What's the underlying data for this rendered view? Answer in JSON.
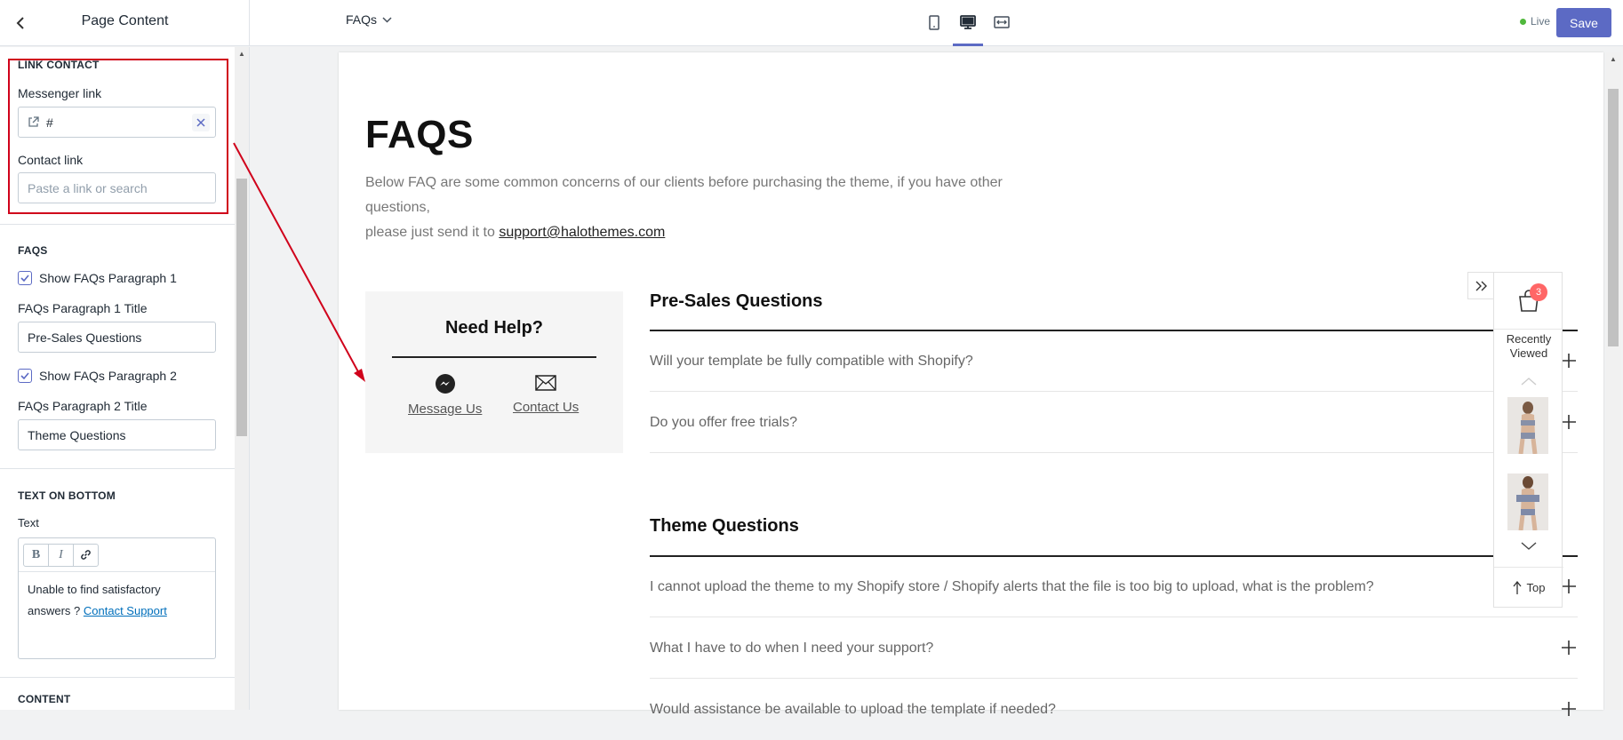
{
  "topbar": {
    "panel_title": "Page Content",
    "page_selector": "FAQs",
    "live_label": "Live",
    "save_label": "Save"
  },
  "sidebar": {
    "link_contact": {
      "heading": "LINK CONTACT",
      "messenger_label": "Messenger link",
      "messenger_value": "#",
      "contact_label": "Contact link",
      "contact_placeholder": "Paste a link or search"
    },
    "faqs": {
      "heading": "FAQS",
      "show_p1": "Show FAQs Paragraph 1",
      "p1_title_label": "FAQs Paragraph 1 Title",
      "p1_title_value": "Pre-Sales Questions",
      "show_p2": "Show FAQs Paragraph 2",
      "p2_title_label": "FAQs Paragraph 2 Title",
      "p2_title_value": "Theme Questions"
    },
    "text_on_bottom": {
      "heading": "TEXT ON BOTTOM",
      "text_label": "Text",
      "rte_buttons": [
        "B",
        "I"
      ],
      "body_text": "Unable to find satisfactory answers ?",
      "body_link": "Contact Support"
    },
    "content_heading": "CONTENT"
  },
  "preview": {
    "title": "FAQS",
    "intro_line1": "Below FAQ are some common concerns of our clients before purchasing the theme, if you have other questions,",
    "intro_line2": "please just send it to",
    "intro_email": "support@halothemes.com",
    "help": {
      "title": "Need Help?",
      "message": "Message Us",
      "contact": "Contact Us"
    },
    "groups": [
      {
        "title": "Pre-Sales Questions",
        "questions": [
          "Will your template be fully compatible with Shopify?",
          "Do you offer free trials?"
        ]
      },
      {
        "title": "Theme Questions",
        "questions": [
          "I cannot upload the theme to my Shopify store / Shopify alerts that the file is too big to upload, what is the problem?",
          "What I have to do when I need your support?",
          "Would assistance be available to upload the template if needed?"
        ]
      }
    ],
    "widget": {
      "cart_count": "3",
      "recently_viewed_line1": "Recently",
      "recently_viewed_line2": "Viewed",
      "top_label": "Top"
    }
  },
  "colors": {
    "accent": "#5c6ac4",
    "highlight": "#d0021b",
    "live": "#50b83c",
    "badge": "#ff6666"
  },
  "icons": [
    "back-icon",
    "chevron-down-icon",
    "mobile-view-icon",
    "desktop-view-icon",
    "fullscreen-view-icon",
    "external-link-icon",
    "close-icon",
    "checkmark-icon",
    "bold-icon",
    "italic-icon",
    "link-icon",
    "messenger-icon",
    "mail-icon",
    "plus-icon",
    "double-chevron-right-icon",
    "shopping-bag-icon",
    "chevron-up-icon",
    "arrow-up-icon"
  ]
}
